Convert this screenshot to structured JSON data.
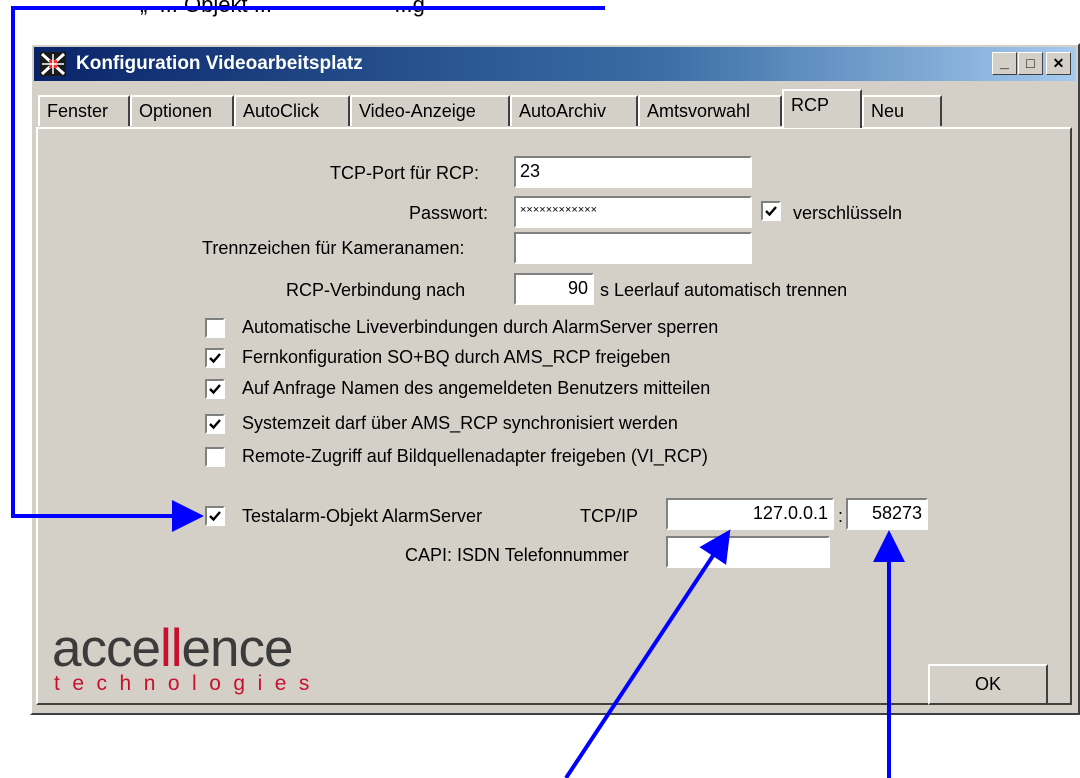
{
  "top_caption": "„  ... Objekt ...                    ...g",
  "window": {
    "title": "Konfiguration Videoarbeitsplatz"
  },
  "title_buttons": {
    "minimize": "_",
    "maximize": "□",
    "close": "✕"
  },
  "tabs": [
    {
      "label": "Fenster"
    },
    {
      "label": "Optionen"
    },
    {
      "label": "AutoClick"
    },
    {
      "label": "Video-Anzeige"
    },
    {
      "label": "AutoArchiv"
    },
    {
      "label": "Amtsvorwahl"
    },
    {
      "label": "RCP",
      "active": true
    },
    {
      "label": "Neu"
    }
  ],
  "rcp": {
    "tcp_port_label": "TCP-Port für RCP:",
    "tcp_port_value": "23",
    "password_label": "Passwort:",
    "password_value": "××××××××××××",
    "encrypt_label": "verschlüsseln",
    "encrypt_checked": true,
    "separator_label": "Trennzeichen für Kameranamen:",
    "separator_value": "",
    "timeout_prefix": "RCP-Verbindung nach",
    "timeout_value": "90",
    "timeout_suffix": "s Leerlauf automatisch trennen"
  },
  "options": [
    {
      "label": "Automatische Liveverbindungen durch AlarmServer sperren",
      "checked": false
    },
    {
      "label": "Fernkonfiguration SO+BQ durch AMS_RCP freigeben",
      "checked": true
    },
    {
      "label": "Auf Anfrage Namen des angemeldeten Benutzers mitteilen",
      "checked": true
    },
    {
      "label": "Systemzeit darf über AMS_RCP synchronisiert werden",
      "checked": true
    },
    {
      "label": "Remote-Zugriff auf Bildquellenadapter freigeben (VI_RCP)",
      "checked": false
    }
  ],
  "testalarm": {
    "label": "Testalarm-Objekt AlarmServer",
    "checked": true,
    "tcpip_label": "TCP/IP",
    "ip_value": "127.0.0.1",
    "colon": ":",
    "port_value": "58273",
    "capi_label": "CAPI: ISDN Telefonnummer",
    "capi_value": ""
  },
  "logo": {
    "word_a": "acce",
    "word_ll": "ll",
    "word_b": "ence",
    "sub": "technologies"
  },
  "ok_button": "OK",
  "colors": {
    "annotation_arrow": "#0000ff",
    "logo_red": "#c8102e",
    "titlebar": "#0a246a"
  }
}
